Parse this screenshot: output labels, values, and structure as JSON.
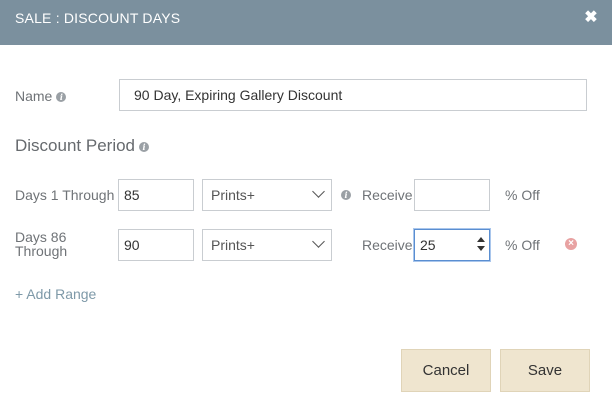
{
  "header": {
    "title": "SALE : DISCOUNT DAYS",
    "close_glyph": "✖"
  },
  "name_field": {
    "label": "Name",
    "value": "90 Day, Expiring Gallery Discount"
  },
  "discount_period": {
    "heading": "Discount Period"
  },
  "ranges": [
    {
      "label": "Days 1 Through",
      "days": "85",
      "product": "Prints+",
      "receive_label": "Receive",
      "receive_value": "",
      "suffix": "% Off"
    },
    {
      "label_line1": "Days 86",
      "label_line2": "Through",
      "days": "90",
      "product": "Prints+",
      "receive_label": "Receive",
      "receive_value": "25",
      "suffix": "% Off"
    }
  ],
  "add_range": "+ Add Range",
  "buttons": {
    "cancel": "Cancel",
    "save": "Save"
  },
  "icons": {
    "info": "info-circle-icon",
    "remove": "remove-circle-icon",
    "close": "close-icon"
  },
  "colors": {
    "header_bg": "#7b909e",
    "button_bg": "#efe5cf",
    "link": "#7e99a8",
    "remove": "#e8a2a2"
  }
}
